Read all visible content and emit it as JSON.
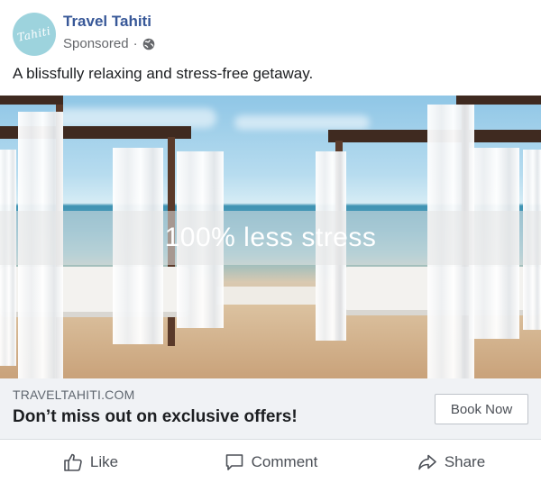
{
  "header": {
    "page_name": "Travel Tahiti",
    "meta_label": "Sponsored",
    "separator": "·",
    "logo_text": "Tahiti",
    "privacy_icon": "globe-icon"
  },
  "post": {
    "caption": "A blissfully relaxing and stress-free getaway."
  },
  "image": {
    "overlay_text": "100% less stress"
  },
  "link_preview": {
    "domain": "TRAVELTAHITI.COM",
    "headline": "Don’t miss out on exclusive offers!",
    "cta_label": "Book Now"
  },
  "actions": [
    {
      "label": "Like",
      "icon": "thumbs-up-icon"
    },
    {
      "label": "Comment",
      "icon": "comment-icon"
    },
    {
      "label": "Share",
      "icon": "share-icon"
    }
  ],
  "colors": {
    "page_name": "#385898",
    "link_bar_bg": "#f0f2f5",
    "avatar_bg": "#9dd3dd"
  }
}
